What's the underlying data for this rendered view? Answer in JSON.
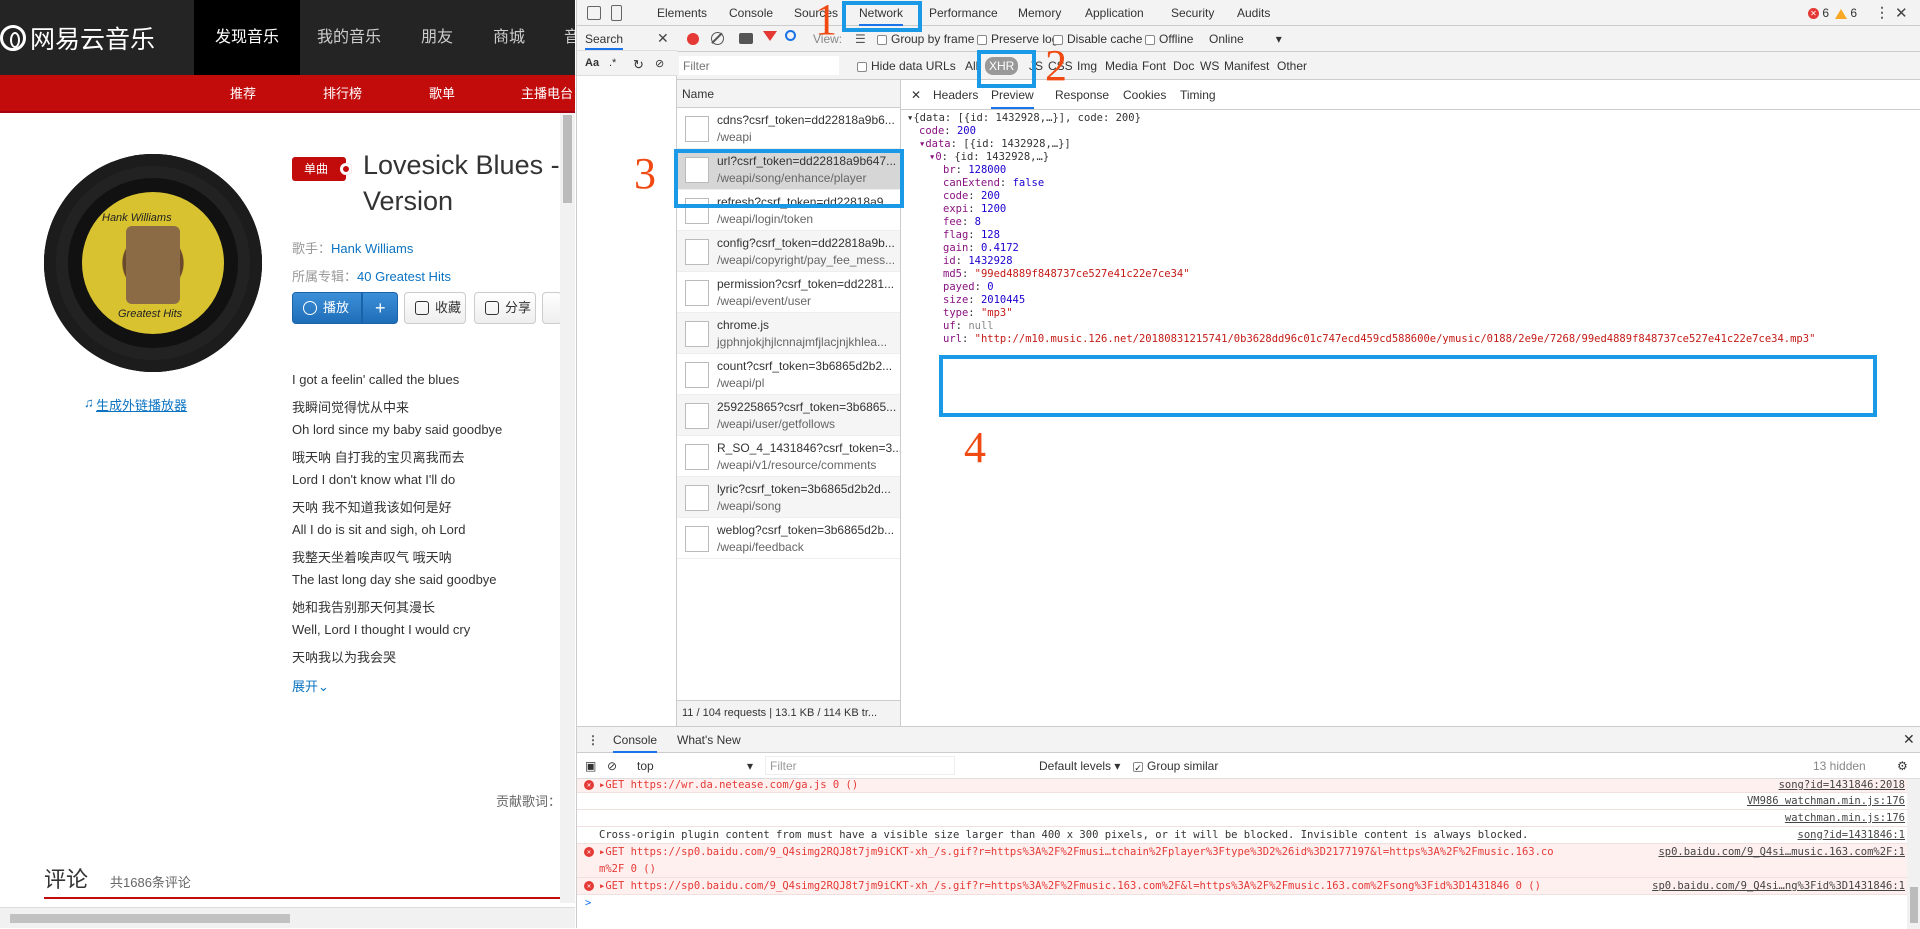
{
  "site": {
    "logo": "网易云音乐",
    "nav": [
      "发现音乐",
      "我的音乐",
      "朋友",
      "商城",
      "音"
    ],
    "subnav": [
      "推荐",
      "排行榜",
      "歌单",
      "主播电台"
    ]
  },
  "song": {
    "cover_text": "Hank Williams",
    "cover_subtext": "Greatest Hits",
    "badge": "单曲",
    "title_line1": "Lovesick Blues -",
    "title_line2": "Version",
    "singer_label": "歌手：",
    "singer": "Hank Williams",
    "album_label": "所属专辑：",
    "album": "40 Greatest Hits",
    "buttons": {
      "play": "播放",
      "add": "+",
      "collect": "收藏",
      "share": "分享"
    },
    "ext_player": "生成外链播放器",
    "lyrics": [
      "I got a feelin' called the blues",
      "我瞬间觉得忧从中来",
      "Oh lord since my baby said goodbye",
      "哦天呐 自打我的宝贝离我而去",
      "Lord I don't know what I'll do",
      "天呐 我不知道我该如何是好",
      "All I do is sit and sigh, oh Lord",
      "我整天坐着唉声叹气 哦天呐",
      "The last long day she said goodbye",
      "她和我告别那天何其漫长",
      "Well, Lord I thought I would cry",
      "天呐我以为我会哭"
    ],
    "expand": "展开",
    "contributor": "贡献歌词：",
    "comment_title": "评论",
    "comment_count": "共1686条评论"
  },
  "devtools": {
    "tabs": [
      "Elements",
      "Console",
      "Sources",
      "Network",
      "Performance",
      "Memory",
      "Application",
      "Security",
      "Audits"
    ],
    "selected_tab": "Network",
    "errors": "6",
    "warnings": "6",
    "search_label": "Search",
    "search_opts": [
      "Aa",
      ".*"
    ],
    "toolbar": {
      "view": "View:",
      "group_by_frame": "Group by frame",
      "preserve_log": "Preserve log",
      "disable_cache": "Disable cache",
      "offline": "Offline",
      "throttle": "Online"
    },
    "filter_placeholder": "Filter",
    "hide_data_urls": "Hide data URLs",
    "filter_types": [
      "All",
      "XHR",
      "JS",
      "CSS",
      "Img",
      "Media",
      "Font",
      "Doc",
      "WS",
      "Manifest",
      "Other"
    ],
    "selected_filter": "XHR",
    "name_header": "Name",
    "requests": [
      {
        "name": "cdns?csrf_token=dd22818a9b6...",
        "path": "/weapi"
      },
      {
        "name": "url?csrf_token=dd22818a9b647...",
        "path": "/weapi/song/enhance/player"
      },
      {
        "name": "refresh?csrf_token=dd22818a9...",
        "path": "/weapi/login/token"
      },
      {
        "name": "config?csrf_token=dd22818a9b...",
        "path": "/weapi/copyright/pay_fee_mess..."
      },
      {
        "name": "permission?csrf_token=dd2281...",
        "path": "/weapi/event/user"
      },
      {
        "name": "chrome.js",
        "path": "jgphnjokjhjlcnnajmfjlacjnjkhlea..."
      },
      {
        "name": "count?csrf_token=3b6865d2b2...",
        "path": "/weapi/pl"
      },
      {
        "name": "259225865?csrf_token=3b6865...",
        "path": "/weapi/user/getfollows"
      },
      {
        "name": "R_SO_4_1431846?csrf_token=3...",
        "path": "/weapi/v1/resource/comments"
      },
      {
        "name": "lyric?csrf_token=3b6865d2b2d...",
        "path": "/weapi/song"
      },
      {
        "name": "weblog?csrf_token=3b6865d2b...",
        "path": "/weapi/feedback"
      }
    ],
    "footer": "11 / 104 requests  |  13.1 KB / 114 KB tr...",
    "detail_tabs": [
      "Headers",
      "Preview",
      "Response",
      "Cookies",
      "Timing"
    ],
    "selected_detail": "Preview",
    "json_lines": [
      {
        "t": "▾{data: [{id: 1432928,…}], code: 200}",
        "k": "",
        "v": "",
        "c": ""
      },
      {
        "t": "",
        "k": "code",
        "v": "200",
        "c": "n"
      },
      {
        "t": "",
        "k": "▾data",
        "v": "[{id: 1432928,…}]",
        "c": ""
      },
      {
        "t": "",
        "k": "▾0",
        "v": "{id: 1432928,…}",
        "c": ""
      },
      {
        "t": "",
        "k": "br",
        "v": "128000",
        "c": "n"
      },
      {
        "t": "",
        "k": "canExtend",
        "v": "false",
        "c": "n"
      },
      {
        "t": "",
        "k": "code",
        "v": "200",
        "c": "n"
      },
      {
        "t": "",
        "k": "expi",
        "v": "1200",
        "c": "n"
      },
      {
        "t": "",
        "k": "fee",
        "v": "8",
        "c": "n"
      },
      {
        "t": "",
        "k": "flag",
        "v": "128",
        "c": "n"
      },
      {
        "t": "",
        "k": "gain",
        "v": "0.4172",
        "c": "n"
      },
      {
        "t": "",
        "k": "id",
        "v": "1432928",
        "c": "n"
      },
      {
        "t": "",
        "k": "md5",
        "v": "\"99ed4889f848737ce527e41c22e7ce34\"",
        "c": "s"
      },
      {
        "t": "",
        "k": "payed",
        "v": "0",
        "c": "n"
      },
      {
        "t": "",
        "k": "size",
        "v": "2010445",
        "c": "n"
      },
      {
        "t": "",
        "k": "type",
        "v": "\"mp3\"",
        "c": "s"
      },
      {
        "t": "",
        "k": "uf",
        "v": "null",
        "c": "g"
      },
      {
        "t": "",
        "k": "url",
        "v": "\"http://m10.music.126.net/20180831215741/0b3628dd96c01c747ecd459cd588600e/ymusic/0188/2e9e/7268/99ed4889f848737ce527e41c22e7ce34.mp3\"",
        "c": "s"
      }
    ],
    "drawer": {
      "tabs": [
        "Console",
        "What's New"
      ],
      "context": "top",
      "filter_placeholder": "Filter",
      "levels": "Default levels",
      "group_similar": "Group similar",
      "hidden": "13 hidden",
      "rows": [
        {
          "type": "err",
          "msg": "▸GET https://wr.da.netease.com/ga.js 0 ()",
          "src": "song?id=1431846:2018"
        },
        {
          "type": "log",
          "msg": "",
          "src": "VM986 watchman.min.js:176"
        },
        {
          "type": "log",
          "msg": "",
          "src": "watchman.min.js:176"
        },
        {
          "type": "log",
          "msg": "Cross-origin plugin content from  must have a visible size larger than 400 x 300 pixels, or it will be blocked. Invisible content is always blocked.",
          "src": "song?id=1431846:1"
        },
        {
          "type": "err",
          "msg": "▸GET https://sp0.baidu.com/9_Q4simg2RQJ8t7jm9iCKT-xh_/s.gif?r=https%3A%2F%2Fmusi…tchain%2Fplayer%3Ftype%3D2%26id%3D2177197&l=https%3A%2F%2Fmusic.163.co",
          "src": "sp0.baidu.com/9_Q4si…music.163.com%2F:1"
        },
        {
          "type": "err2",
          "msg": "m%2F 0 ()",
          "src": ""
        },
        {
          "type": "err",
          "msg": "▸GET https://sp0.baidu.com/9_Q4simg2RQJ8t7jm9iCKT-xh_/s.gif?r=https%3A%2F%2Fmusic.163.com%2F&l=https%3A%2F%2Fmusic.163.com%2Fsong%3Fid%3D1431846 0 ()",
          "src": "sp0.baidu.com/9_Q4si…ng%3Fid%3D1431846:1"
        }
      ],
      "prompt": ">"
    }
  },
  "annotations": [
    "1",
    "2",
    "3",
    "4"
  ],
  "colors": {
    "accent": "#c20c0c",
    "annotation_box": "#1a9ae6",
    "annotation_num": "#f04a12",
    "devtools_blue": "#1a73e8"
  }
}
